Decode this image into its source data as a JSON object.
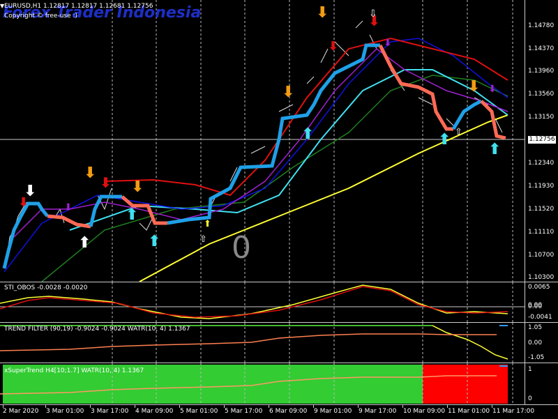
{
  "window": {
    "symbol_line": "EURUSD,H1  1.12817 1.12817 1.12681 1.12756",
    "copyright": "Copyright © free-use :)",
    "watermark": "Forex Trader Indonesia",
    "zero_label": "0",
    "current_price": "1.12756"
  },
  "main_scale": [
    "1.14780",
    "1.14370",
    "1.13960",
    "1.13560",
    "1.13150",
    "1.12340",
    "1.11930",
    "1.11520",
    "1.11110",
    "1.10700",
    "1.10300"
  ],
  "panes": {
    "osc1": {
      "title": "STI_OBOS -0.0028 -0.0020",
      "scale": [
        "0.0065",
        "0.00",
        "0.00",
        "-0.0041"
      ]
    },
    "osc2": {
      "title": "TREND FILTER (90,19) -0.9024 -0.9024  WATR(10, 4) 1.1367",
      "scale": [
        "1.05",
        "0.00",
        "-1.05"
      ]
    },
    "osc3": {
      "title": "xSuperTrend H4[10;1.7]  WATR(10, 4) 1.1367",
      "scale": [
        "1",
        "0"
      ]
    }
  },
  "time_axis": [
    "2 Mar 2020",
    "3 Mar 01:00",
    "3 Mar 17:00",
    "4 Mar 09:00",
    "5 Mar 01:00",
    "5 Mar 17:00",
    "6 Mar 09:00",
    "9 Mar 01:00",
    "9 Mar 17:00",
    "10 Mar 09:00",
    "11 Mar 01:00",
    "11 Mar 17:00"
  ],
  "colors": {
    "stairs_up": "#1fa0e8",
    "stairs_down": "#ff6a55",
    "ma_yellow": "#ffff33",
    "ma_red": "#e01010",
    "ma_cyan": "#40e0f0",
    "ma_blue": "#1010e0",
    "ma_green": "#208020",
    "ma_purple": "#a020d0",
    "supertrend_green": "#33cc33",
    "supertrend_red": "#ff0000"
  }
}
